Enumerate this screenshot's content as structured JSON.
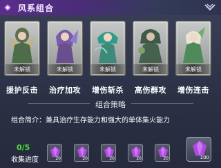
{
  "header": {
    "title": "风系组合"
  },
  "cards": [
    {
      "label": "援护反击",
      "status": "未解锁"
    },
    {
      "label": "治疗加攻",
      "status": "未解锁"
    },
    {
      "label": "增伤斩杀",
      "status": "未解锁"
    },
    {
      "label": "高伤群攻",
      "status": "未解锁"
    },
    {
      "label": "增伤连击",
      "status": "未解锁"
    }
  ],
  "strategy": {
    "title": "组合策略",
    "intro_label": "组合简介：",
    "intro_text": "兼具治疗生存能力和强大的单体集火能力"
  },
  "progress": {
    "count": "0/5",
    "label": "收集进度"
  },
  "rewards": [
    {
      "count": "20"
    },
    {
      "count": "20"
    },
    {
      "count": "20"
    },
    {
      "count": "20"
    },
    {
      "count": "20"
    },
    {
      "count": "100"
    }
  ],
  "colors": {
    "accent": "#5b2d8a",
    "progress": "#4be040",
    "gem": "#b04be0"
  }
}
